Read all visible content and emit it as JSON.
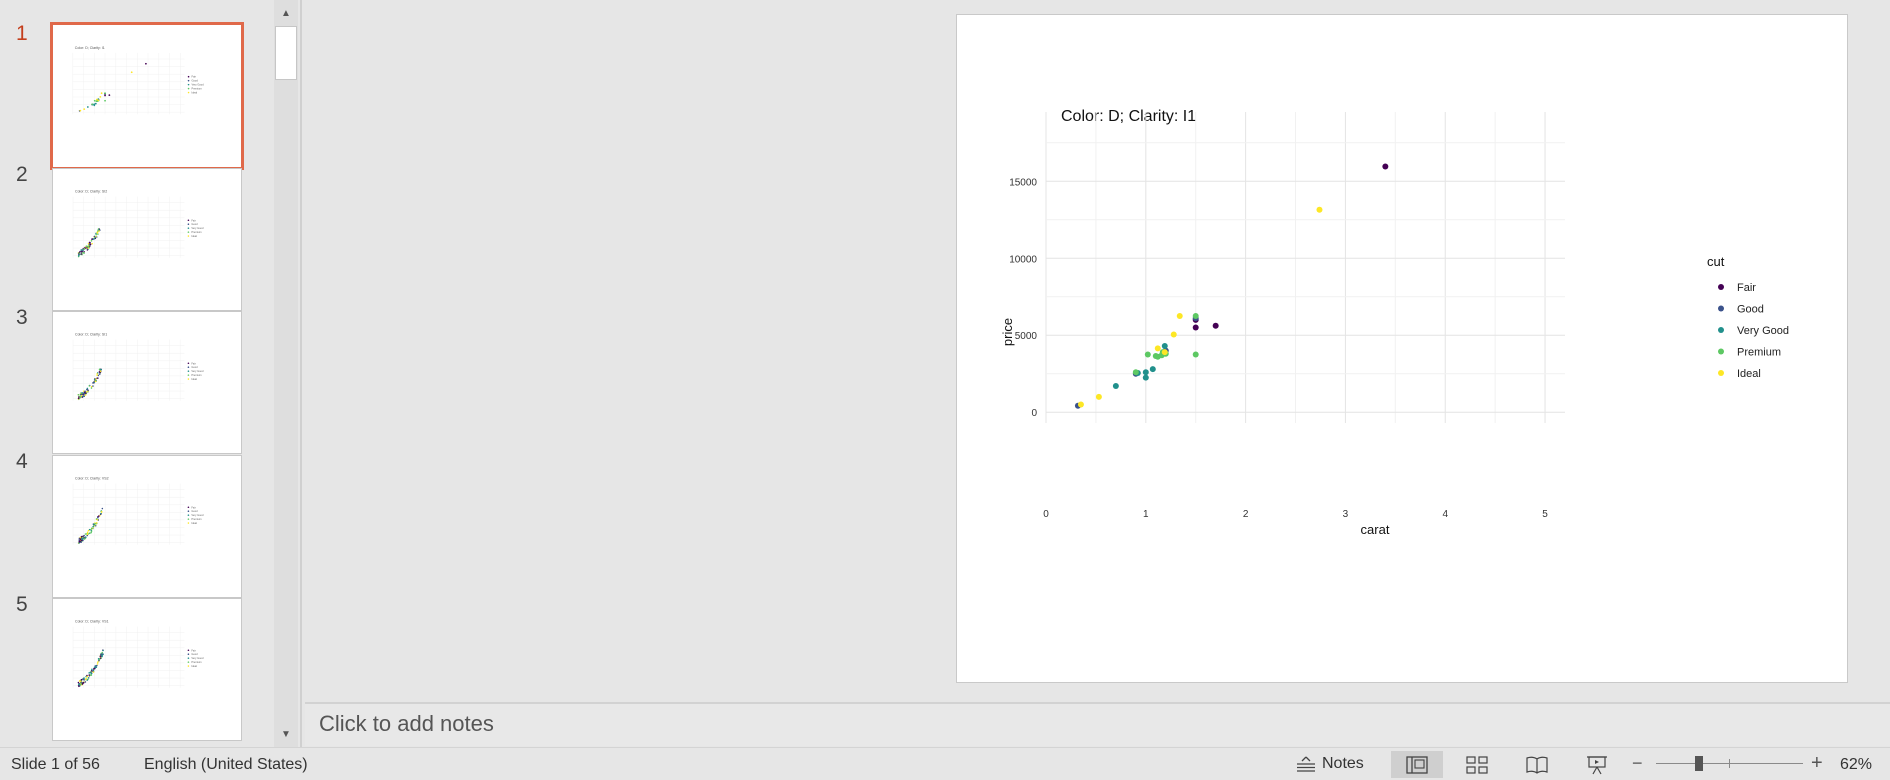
{
  "thumbnails": {
    "items": [
      {
        "number": "1",
        "title": "Color: D; Clarity: I1",
        "active": true
      },
      {
        "number": "2",
        "title": "Color: D; Clarity: SI2",
        "active": false
      },
      {
        "number": "3",
        "title": "Color: D; Clarity: SI1",
        "active": false
      },
      {
        "number": "4",
        "title": "Color: D; Clarity: VS2",
        "active": false
      },
      {
        "number": "5",
        "title": "Color: D; Clarity: VS1",
        "active": false
      }
    ]
  },
  "slide": {
    "chart_data": {
      "type": "scatter",
      "title": "Color: D; Clarity: I1",
      "xlabel": "carat",
      "ylabel": "price",
      "xlim": [
        0,
        5.2
      ],
      "ylim": [
        -700,
        19500
      ],
      "x_ticks": [
        "0",
        "1",
        "2",
        "3",
        "4",
        "5"
      ],
      "y_ticks": [
        "0",
        "5000",
        "10000",
        "15000"
      ],
      "grid": true,
      "legend": {
        "title": "cut",
        "position": "right",
        "entries": [
          {
            "name": "Fair",
            "color": "#440154"
          },
          {
            "name": "Good",
            "color": "#3b528b"
          },
          {
            "name": "Very Good",
            "color": "#21908c"
          },
          {
            "name": "Premium",
            "color": "#5dc863"
          },
          {
            "name": "Ideal",
            "color": "#fde725"
          }
        ]
      },
      "series": [
        {
          "name": "Fair",
          "points": [
            [
              3.4,
              15960
            ],
            [
              1.7,
              5620
            ],
            [
              1.5,
              6000
            ],
            [
              1.5,
              5500
            ]
          ]
        },
        {
          "name": "Good",
          "points": [
            [
              0.32,
              420
            ],
            [
              0.9,
              2500
            ],
            [
              1.2,
              4000
            ],
            [
              1.5,
              6100
            ]
          ]
        },
        {
          "name": "Very Good",
          "points": [
            [
              0.7,
              1700
            ],
            [
              0.92,
              2550
            ],
            [
              1.0,
              2250
            ],
            [
              1.07,
              2800
            ],
            [
              1.19,
              4300
            ],
            [
              1.0,
              2600
            ]
          ]
        },
        {
          "name": "Premium",
          "points": [
            [
              0.9,
              2600
            ],
            [
              1.02,
              3750
            ],
            [
              1.12,
              3600
            ],
            [
              1.16,
              3700
            ],
            [
              1.2,
              3800
            ],
            [
              1.5,
              6250
            ],
            [
              1.5,
              3750
            ],
            [
              1.1,
              3650
            ],
            [
              1.17,
              3900
            ]
          ]
        },
        {
          "name": "Ideal",
          "points": [
            [
              0.35,
              500
            ],
            [
              0.53,
              1000
            ],
            [
              1.12,
              4150
            ],
            [
              1.28,
              5050
            ],
            [
              1.34,
              6250
            ],
            [
              1.19,
              3900
            ],
            [
              2.74,
              13150
            ]
          ]
        }
      ]
    }
  },
  "notes": {
    "placeholder": "Click to add notes"
  },
  "status": {
    "slide_counter": "Slide 1 of 56",
    "language": "English (United States)",
    "notes_label": "Notes",
    "zoom": "62%",
    "zoom_out_label": "−",
    "zoom_in_label": "+",
    "zoom_fraction": 0.29
  }
}
